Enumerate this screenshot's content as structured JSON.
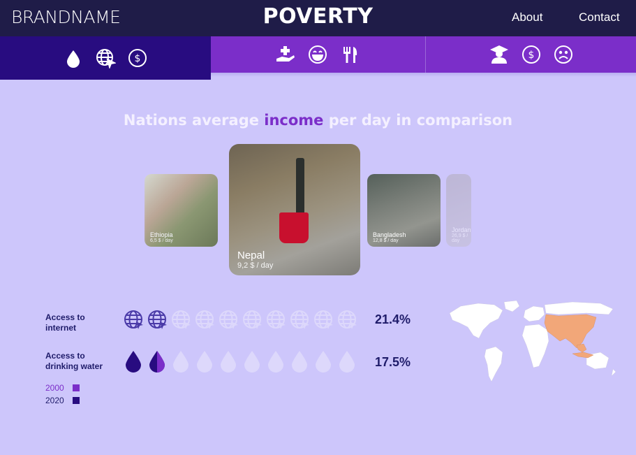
{
  "header": {
    "brand": "BRANDNAME",
    "title": "POVERTY",
    "nav": {
      "about": "About",
      "contact": "Contact"
    }
  },
  "tabs": [
    {
      "icons": [
        "water-drop-icon",
        "globe-cursor-icon",
        "dollar-coin-icon"
      ],
      "active": true
    },
    {
      "icons": [
        "medical-hand-icon",
        "happy-face-icon",
        "fork-knife-icon"
      ],
      "active": false
    },
    {
      "icons": [
        "graduation-person-icon",
        "dollar-coin-icon",
        "sad-face-icon"
      ],
      "active": false
    }
  ],
  "headline": {
    "before": "Nations average ",
    "highlight": "income",
    "after": " per day in comparison"
  },
  "carousel": [
    {
      "country": "Ethiopia",
      "value": "6,5 $ / day"
    },
    {
      "country": "Nepal",
      "value": "9,2 $ / day"
    },
    {
      "country": "Bangladesh",
      "value": "12,8 $ / day"
    },
    {
      "country": "Jordan",
      "value": "26,9 $ / day"
    }
  ],
  "stats": {
    "internet": {
      "label_line1": "Access to",
      "label_line2": "internet",
      "percent_text": "21.4%",
      "percent": 21.4
    },
    "water": {
      "label_line1": "Access to",
      "label_line2": "drinking water",
      "percent_text": "17.5%",
      "percent": 17.5
    }
  },
  "legend": [
    {
      "label": "2000",
      "color": "#7b2ec9"
    },
    {
      "label": "2020",
      "color": "#280c80"
    }
  ],
  "colors": {
    "header_bg": "#1f1c48",
    "tab_active": "#280c80",
    "tab_bg": "#7b2ec9",
    "page_bg": "#cdc6fb",
    "highlight": "#7b2ec9",
    "map_highlight": "#f2a779"
  }
}
